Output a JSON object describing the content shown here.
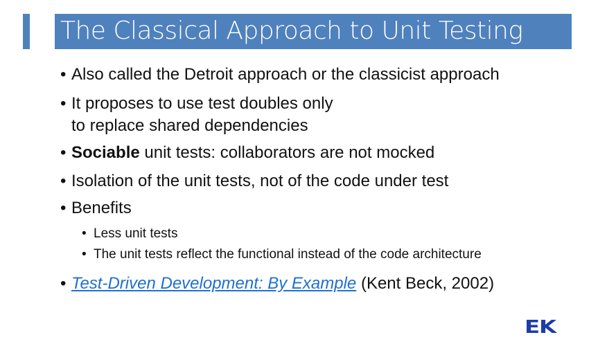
{
  "title": "The Classical Approach to Unit Testing",
  "bullet_glyph": "•",
  "bullets": [
    {
      "text": "Also called the Detroit approach or the classicist approach"
    },
    {
      "line1": "It proposes to use test doubles only",
      "line2": "to replace shared dependencies"
    },
    {
      "bold": "Sociable",
      "rest": " unit tests: collaborators are not mocked"
    },
    {
      "text": "Isolation of the unit tests, not of the code under test"
    },
    {
      "text": "Benefits",
      "sub": [
        "Less unit tests",
        "The unit tests reflect the functional instead of the code architecture"
      ]
    },
    {
      "link": "Test-Driven Development: By Example",
      "rest": " (Kent Beck, 2002)"
    }
  ],
  "logo_text": "EK",
  "colors": {
    "accent": "#4f81bd",
    "link": "#1e6fd0",
    "logo": "#1d3ea3"
  }
}
